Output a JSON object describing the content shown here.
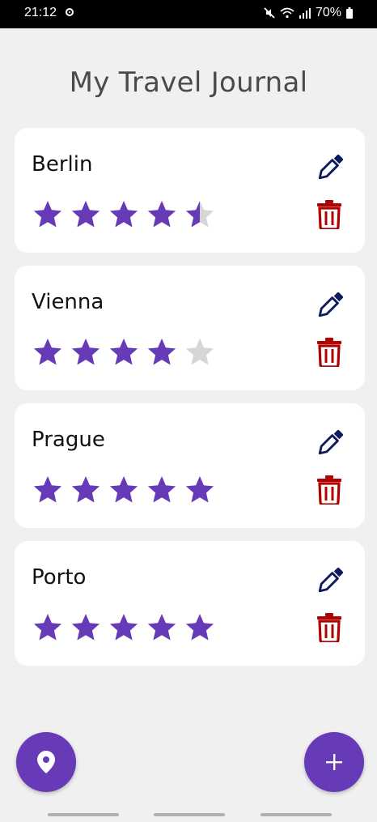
{
  "status_bar": {
    "time": "21:12",
    "battery": "70%",
    "icons": [
      "sync-ring-icon",
      "mute-icon",
      "wifi-icon",
      "signal-icon",
      "battery-icon"
    ]
  },
  "app": {
    "title": "My Travel Journal"
  },
  "colors": {
    "star_filled": "#673ab7",
    "star_empty": "#d6d6d6",
    "edit_icon": "#0d1a5e",
    "delete_icon": "#b00000",
    "fab": "#673ab7"
  },
  "journal": {
    "entries": [
      {
        "city": "Berlin",
        "rating": 4.5
      },
      {
        "city": "Vienna",
        "rating": 4
      },
      {
        "city": "Prague",
        "rating": 5
      },
      {
        "city": "Porto",
        "rating": 5
      }
    ],
    "max_rating": 5
  },
  "fabs": {
    "left_icon": "location-pin-icon",
    "right_icon": "plus-icon"
  }
}
